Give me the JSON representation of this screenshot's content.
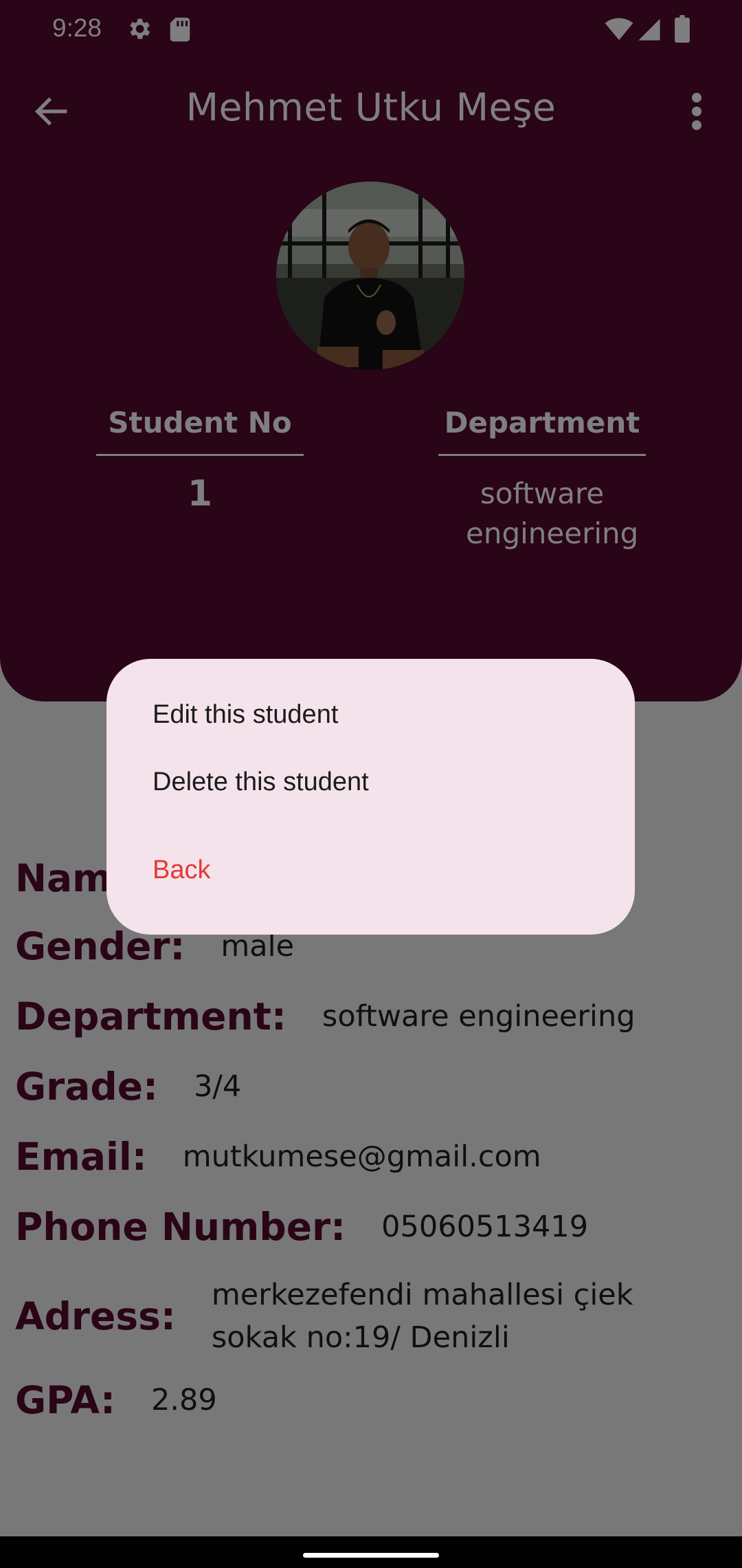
{
  "status_bar": {
    "time": "9:28",
    "icons": [
      "gear-icon",
      "sd-card-icon",
      "wifi-icon",
      "signal-icon",
      "battery-icon"
    ]
  },
  "app_bar": {
    "title": "Mehmet Utku Meşe",
    "back_icon": "arrow-back-icon",
    "menu_icon": "more-vert-icon"
  },
  "summary": {
    "student_no_label": "Student No",
    "student_no_value": "1",
    "department_label": "Department",
    "department_value": "software engineering"
  },
  "details": [
    {
      "label": "Name:",
      "value": ""
    },
    {
      "label": "Gender:",
      "value": "male"
    },
    {
      "label": "Department:",
      "value": "software engineering"
    },
    {
      "label": "Grade:",
      "value": "3/4"
    },
    {
      "label": "Email:",
      "value": "mutkumese@gmail.com"
    },
    {
      "label": "Phone Number:",
      "value": "05060513419"
    },
    {
      "label": "Adress:",
      "value": "merkezefendi mahallesi çiek sokak no:19/ Denizli"
    },
    {
      "label": "GPA:",
      "value": "2.89"
    }
  ],
  "dialog": {
    "edit": "Edit this student",
    "delete": "Delete this student",
    "back": "Back"
  },
  "colors": {
    "primary": "#54082f",
    "dialog_bg": "#f4e3ea",
    "danger": "#e53935"
  }
}
